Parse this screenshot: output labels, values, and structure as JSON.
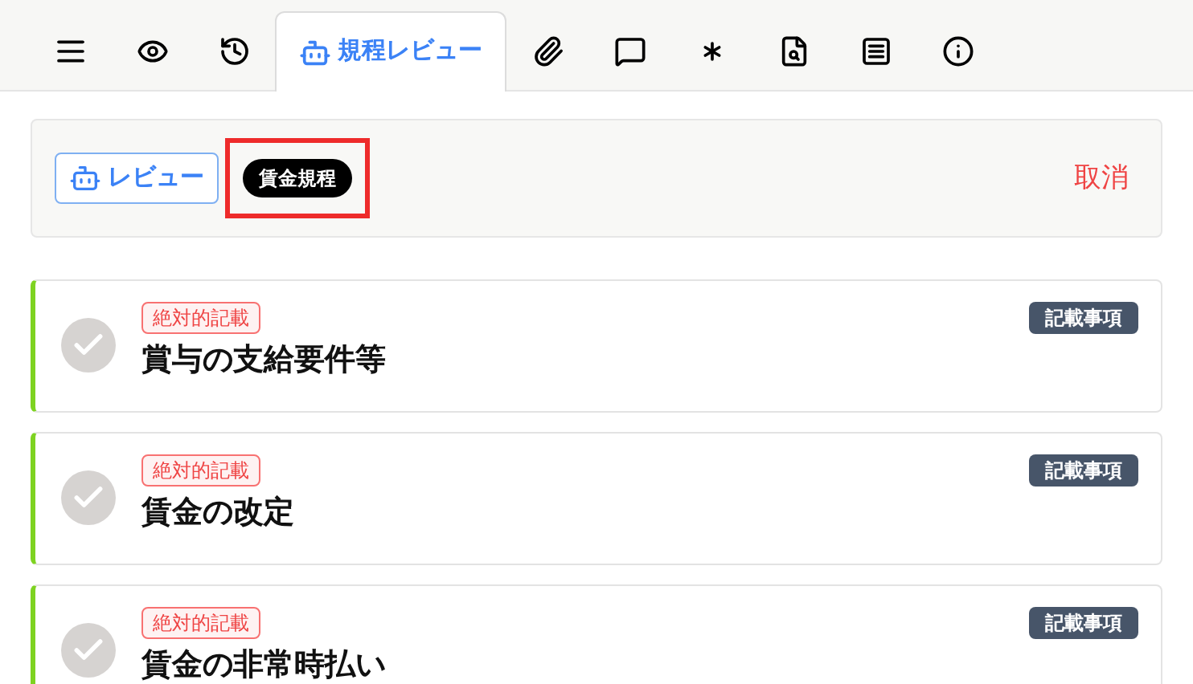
{
  "tabs": [
    {
      "kind": "menu",
      "selected": false
    },
    {
      "kind": "eye",
      "selected": false
    },
    {
      "kind": "history",
      "selected": false
    },
    {
      "kind": "robot",
      "label": "規程レビュー",
      "selected": true
    },
    {
      "kind": "paperclip",
      "selected": false
    },
    {
      "kind": "comment",
      "selected": false
    },
    {
      "kind": "asterisk",
      "selected": false
    },
    {
      "kind": "doc-search",
      "selected": false
    },
    {
      "kind": "list",
      "selected": false
    },
    {
      "kind": "info",
      "selected": false
    }
  ],
  "toolbar": {
    "review_button": "レビュー",
    "badge": {
      "label": "賃金規程",
      "highlighted": true
    },
    "cancel": "取消"
  },
  "items": [
    {
      "tag": "絶対的記載",
      "category": "記載事項",
      "title": "賞与の支給要件等",
      "checked": false
    },
    {
      "tag": "絶対的記載",
      "category": "記載事項",
      "title": "賃金の改定",
      "checked": false
    },
    {
      "tag": "絶対的記載",
      "category": "記載事項",
      "title": "賃金の非常時払い",
      "checked": false
    }
  ]
}
